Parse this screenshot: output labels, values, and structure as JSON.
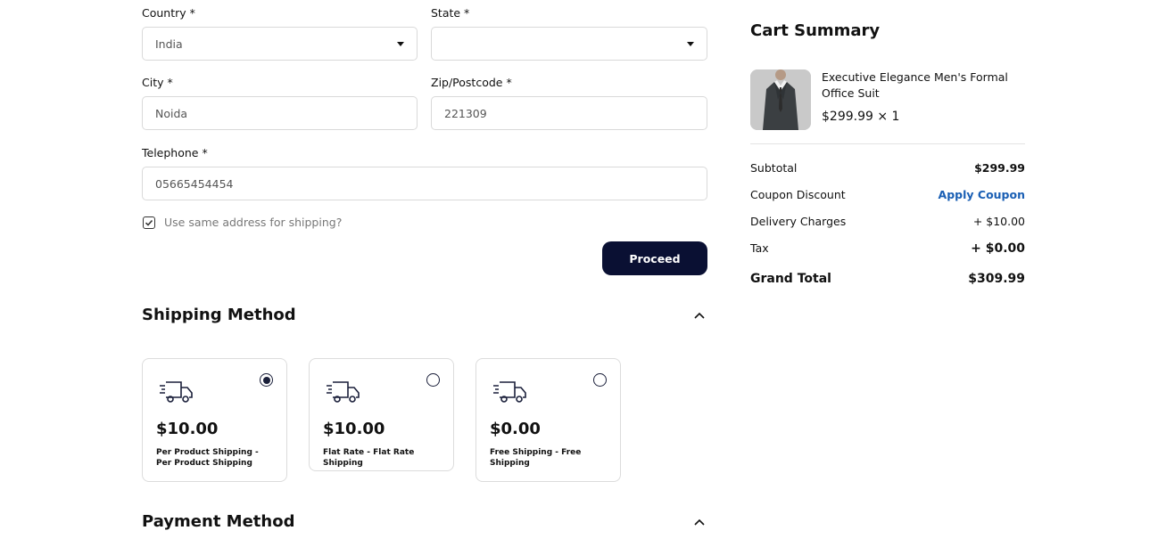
{
  "address": {
    "country_label": "Country *",
    "country_value": "India",
    "state_label": "State *",
    "state_value": "",
    "city_label": "City *",
    "city_value": "Noida",
    "zip_label": "Zip/Postcode *",
    "zip_value": "221309",
    "telephone_label": "Telephone *",
    "telephone_value": "05665454454",
    "same_address_label": "Use same address for shipping?",
    "same_address_checked": true,
    "proceed_label": "Proceed"
  },
  "shipping": {
    "title": "Shipping Method",
    "options": [
      {
        "price": "$10.00",
        "desc": "Per Product Shipping - Per Product Shipping",
        "selected": true
      },
      {
        "price": "$10.00",
        "desc": "Flat Rate - Flat Rate Shipping",
        "selected": false
      },
      {
        "price": "$0.00",
        "desc": "Free Shipping - Free Shipping",
        "selected": false
      }
    ]
  },
  "payment": {
    "title": "Payment Method"
  },
  "cart": {
    "title": "Cart Summary",
    "item_name": "Executive Elegance Men's Formal Office Suit",
    "item_price": "$299.99 × 1",
    "subtotal_label": "Subtotal",
    "subtotal_value": "$299.99",
    "coupon_label": "Coupon Discount",
    "coupon_action": "Apply Coupon",
    "delivery_label": "Delivery Charges",
    "delivery_value": "+ $10.00",
    "tax_label": "Tax",
    "tax_value": "+ $0.00",
    "grand_label": "Grand Total",
    "grand_value": "$309.99"
  },
  "colors": {
    "primary": "#0a1033",
    "link": "#1a5fb4",
    "border": "#d9d9d9"
  }
}
